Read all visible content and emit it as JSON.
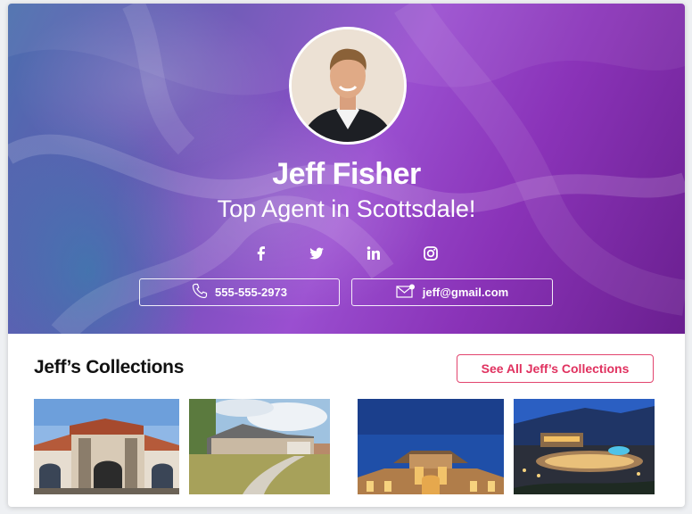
{
  "profile": {
    "name": "Jeff Fisher",
    "tagline": "Top Agent in Scottsdale!",
    "phone": "555-555-2973",
    "email": "jeff@gmail.com"
  },
  "social": [
    {
      "name": "facebook-icon"
    },
    {
      "name": "twitter-icon"
    },
    {
      "name": "linkedin-icon"
    },
    {
      "name": "instagram-icon"
    }
  ],
  "collections": {
    "title": "Jeff’s Collections",
    "see_all_label": "See All Jeff’s Collections",
    "items": [
      {
        "name": "mediterranean-house-photo"
      },
      {
        "name": "suburban-house-photo"
      },
      {
        "name": "night-villa-photo"
      },
      {
        "name": "hillside-estate-photo"
      }
    ]
  },
  "colors": {
    "accent": "#e0315f",
    "hero_start": "#4b6fae",
    "hero_end": "#6a1f8f"
  }
}
